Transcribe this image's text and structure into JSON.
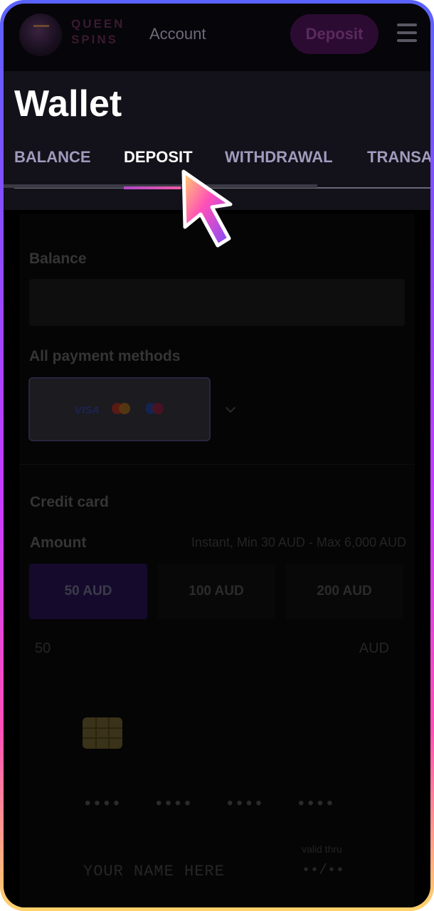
{
  "header": {
    "brand_line1": "QUEEN",
    "brand_line2": "SPINS",
    "nav_account": "Account",
    "deposit_button": "Deposit",
    "menu_icon": "hamburger-menu-icon"
  },
  "wallet": {
    "title": "Wallet",
    "tabs": [
      {
        "label": "BALANCE",
        "active": false
      },
      {
        "label": "DEPOSIT",
        "active": true
      },
      {
        "label": "WITHDRAWAL",
        "active": false
      },
      {
        "label": "TRANSA",
        "active": false
      }
    ]
  },
  "deposit": {
    "balance_label": "Balance",
    "balance_value": "",
    "methods_label": "All payment methods",
    "method_logos": [
      "VISA",
      "mastercard-icon",
      "maestro-icon"
    ],
    "credit_card_label": "Credit card",
    "amount_label": "Amount",
    "amount_note": "Instant, Min 30 AUD - Max 6,000 AUD",
    "amount_options": [
      {
        "label": "50 AUD",
        "selected": true
      },
      {
        "label": "100 AUD",
        "selected": false
      },
      {
        "label": "200 AUD",
        "selected": false
      }
    ],
    "amount_input_value": "50",
    "amount_currency": "AUD",
    "card_number_groups": [
      "••••",
      "••••",
      "••••",
      "••••"
    ],
    "valid_thru_label": "valid thru",
    "card_name_placeholder": "YOUR NAME HERE",
    "card_expiry_placeholder": "••/••"
  },
  "colors": {
    "accent_gradient_start": "#b348c9",
    "accent_gradient_end": "#f05aa9",
    "page_background": "#000000"
  }
}
